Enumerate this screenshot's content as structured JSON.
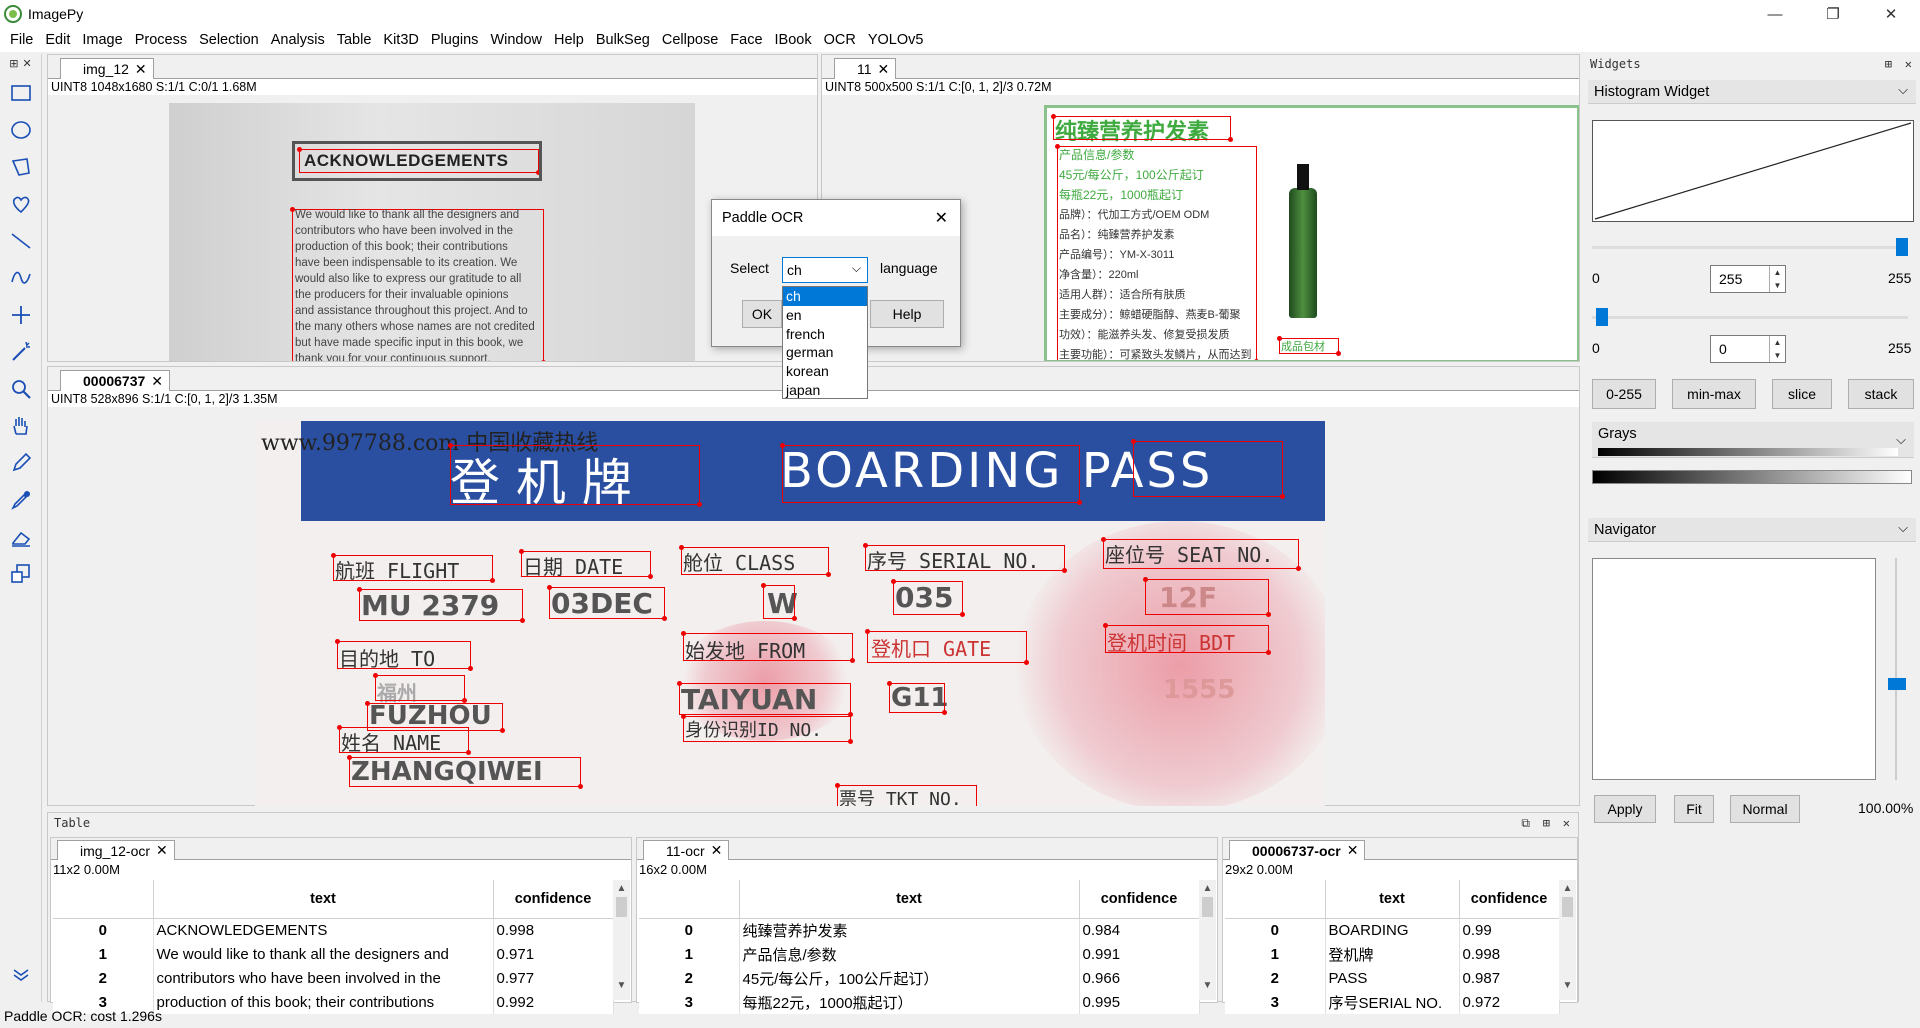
{
  "app": {
    "title": "ImagePy",
    "window_controls": [
      "—",
      "❐",
      "✕"
    ]
  },
  "menu": [
    "File",
    "Edit",
    "Image",
    "Process",
    "Selection",
    "Analysis",
    "Table",
    "Kit3D",
    "Plugins",
    "Window",
    "Help",
    "BulkSeg",
    "Cellpose",
    "Face",
    "IBook",
    "OCR",
    "YOLOv5"
  ],
  "toolbar": {
    "tools": [
      "rectangle-tool",
      "ellipse-tool",
      "polygon-tool",
      "freehand-tool",
      "line-tool",
      "polyline-tool",
      "point-tool",
      "magic-wand-tool",
      "zoom-tool",
      "hand-tool",
      "pencil-tool",
      "color-picker-tool",
      "eraser-tool",
      "bucket-tool"
    ]
  },
  "images": {
    "img12": {
      "tab": "img_12",
      "info": "UINT8  1048x1680  S:1/1  C:0/1  1.68M",
      "heading": "ACKNOWLEDGEMENTS",
      "lines": [
        "We would like to thank all the designers and",
        "contributors who have been involved in the",
        "production of this book; their contributions",
        "have been indispensable to its creation. We",
        "would also like to express our gratitude to all",
        "the producers for their invaluable opinions",
        "and assistance throughout this project. And to",
        "the many others whose names are not credited",
        "but have made specific input in this book, we",
        "thank you for your continuous support."
      ]
    },
    "img11": {
      "tab": "11",
      "info": "UINT8  500x500  S:1/1  C:[0, 1, 2]/3  0.72M",
      "title": "纯臻营养护发素",
      "lines": [
        "产品信息/参数",
        "45元/每公斤，100公斤起订",
        "每瓶22元，1000瓶起订",
        "品牌）：代加工方式/OEM ODM",
        "品名）：纯臻营养护发素",
        "产品编号）：YM-X-3011",
        "净含量）：220ml",
        "适用人群）：适合所有肤质",
        "主要成分）：鲸蜡硬脂醇、燕麦B-葡聚",
        "功效）：能滋养头发、修复受损发质",
        "主要功能）：可紧致头发鳞片，从而达到"
      ],
      "side": "成品包材"
    },
    "bp": {
      "tab": "00006737",
      "info": "UINT8  528x896  S:1/1  C:[0, 1, 2]/3  1.35M",
      "watermark": "www.997788.com 中国收藏热线",
      "title_cn": "登 机 牌",
      "title_en": "BOARDING  PASS",
      "fields": {
        "flight": "航班  FLIGHT",
        "date": "日期  DATE",
        "class": "舱位  CLASS",
        "serial": "序号  SERIAL NO.",
        "seat": "座位号  SEAT NO.",
        "flight_v": "MU 2379",
        "date_v": "03DEC",
        "class_v": "W",
        "serial_v": "035",
        "seat_v": "12F",
        "dest": "目的地  TO",
        "dest_cn": "福州",
        "dest_v": "FUZHOU",
        "from": "始发地  FROM",
        "from_v": "TAIYUAN",
        "gate": "登机口  GATE",
        "gate_v": "G11",
        "bdt": "登机时间  BDT",
        "bdt_v": "1555",
        "id": "身份识别ID NO.",
        "name": "姓名  NAME",
        "name_v": "ZHANGQIWEI",
        "tkt": "票号  TKT NO."
      }
    }
  },
  "dialog": {
    "title": "Paddle OCR",
    "select_label": "Select",
    "language_label": "language",
    "selected": "ch",
    "options": [
      "ch",
      "en",
      "french",
      "german",
      "korean",
      "japan"
    ],
    "ok": "OK",
    "help": "Help"
  },
  "widgets": {
    "header": "Widgets",
    "histogram_title": "Histogram Widget",
    "min_label": "0",
    "max_label": "255",
    "high_value": "255",
    "low_value": "0",
    "buttons": [
      "0-255",
      "min-max",
      "slice",
      "stack"
    ],
    "colormap": "Grays",
    "navigator_title": "Navigator",
    "nav_buttons": [
      "Apply",
      "Fit",
      "Normal"
    ],
    "zoom": "100.00%"
  },
  "table": {
    "header": "Table",
    "panels": [
      {
        "tab": "img_12-ocr",
        "info": "11x2  0.00M",
        "columns": [
          "",
          "text",
          "confidence"
        ],
        "rows": [
          [
            "0",
            "ACKNOWLEDGEMENTS",
            "0.998"
          ],
          [
            "1",
            "We would like to thank all the designers and",
            "0.971"
          ],
          [
            "2",
            "contributors who have been involved in the",
            "0.977"
          ],
          [
            "3",
            "production of this book; their contributions",
            "0.992"
          ]
        ]
      },
      {
        "tab": "11-ocr",
        "info": "16x2  0.00M",
        "columns": [
          "",
          "text",
          "confidence"
        ],
        "rows": [
          [
            "0",
            "纯臻营养护发素",
            "0.984"
          ],
          [
            "1",
            "产品信息/参数",
            "0.991"
          ],
          [
            "2",
            "45元/每公斤，100公斤起订）",
            "0.966"
          ],
          [
            "3",
            "每瓶22元，1000瓶起订）",
            "0.995"
          ]
        ]
      },
      {
        "tab": "00006737-ocr",
        "info": "29x2  0.00M",
        "columns": [
          "",
          "text",
          "confidence"
        ],
        "rows": [
          [
            "0",
            "BOARDING",
            "0.99"
          ],
          [
            "1",
            "登机牌",
            "0.998"
          ],
          [
            "2",
            "PASS",
            "0.987"
          ],
          [
            "3",
            "序号SERIAL NO.",
            "0.972"
          ]
        ]
      }
    ]
  },
  "status": "Paddle OCR: cost 1.296s"
}
